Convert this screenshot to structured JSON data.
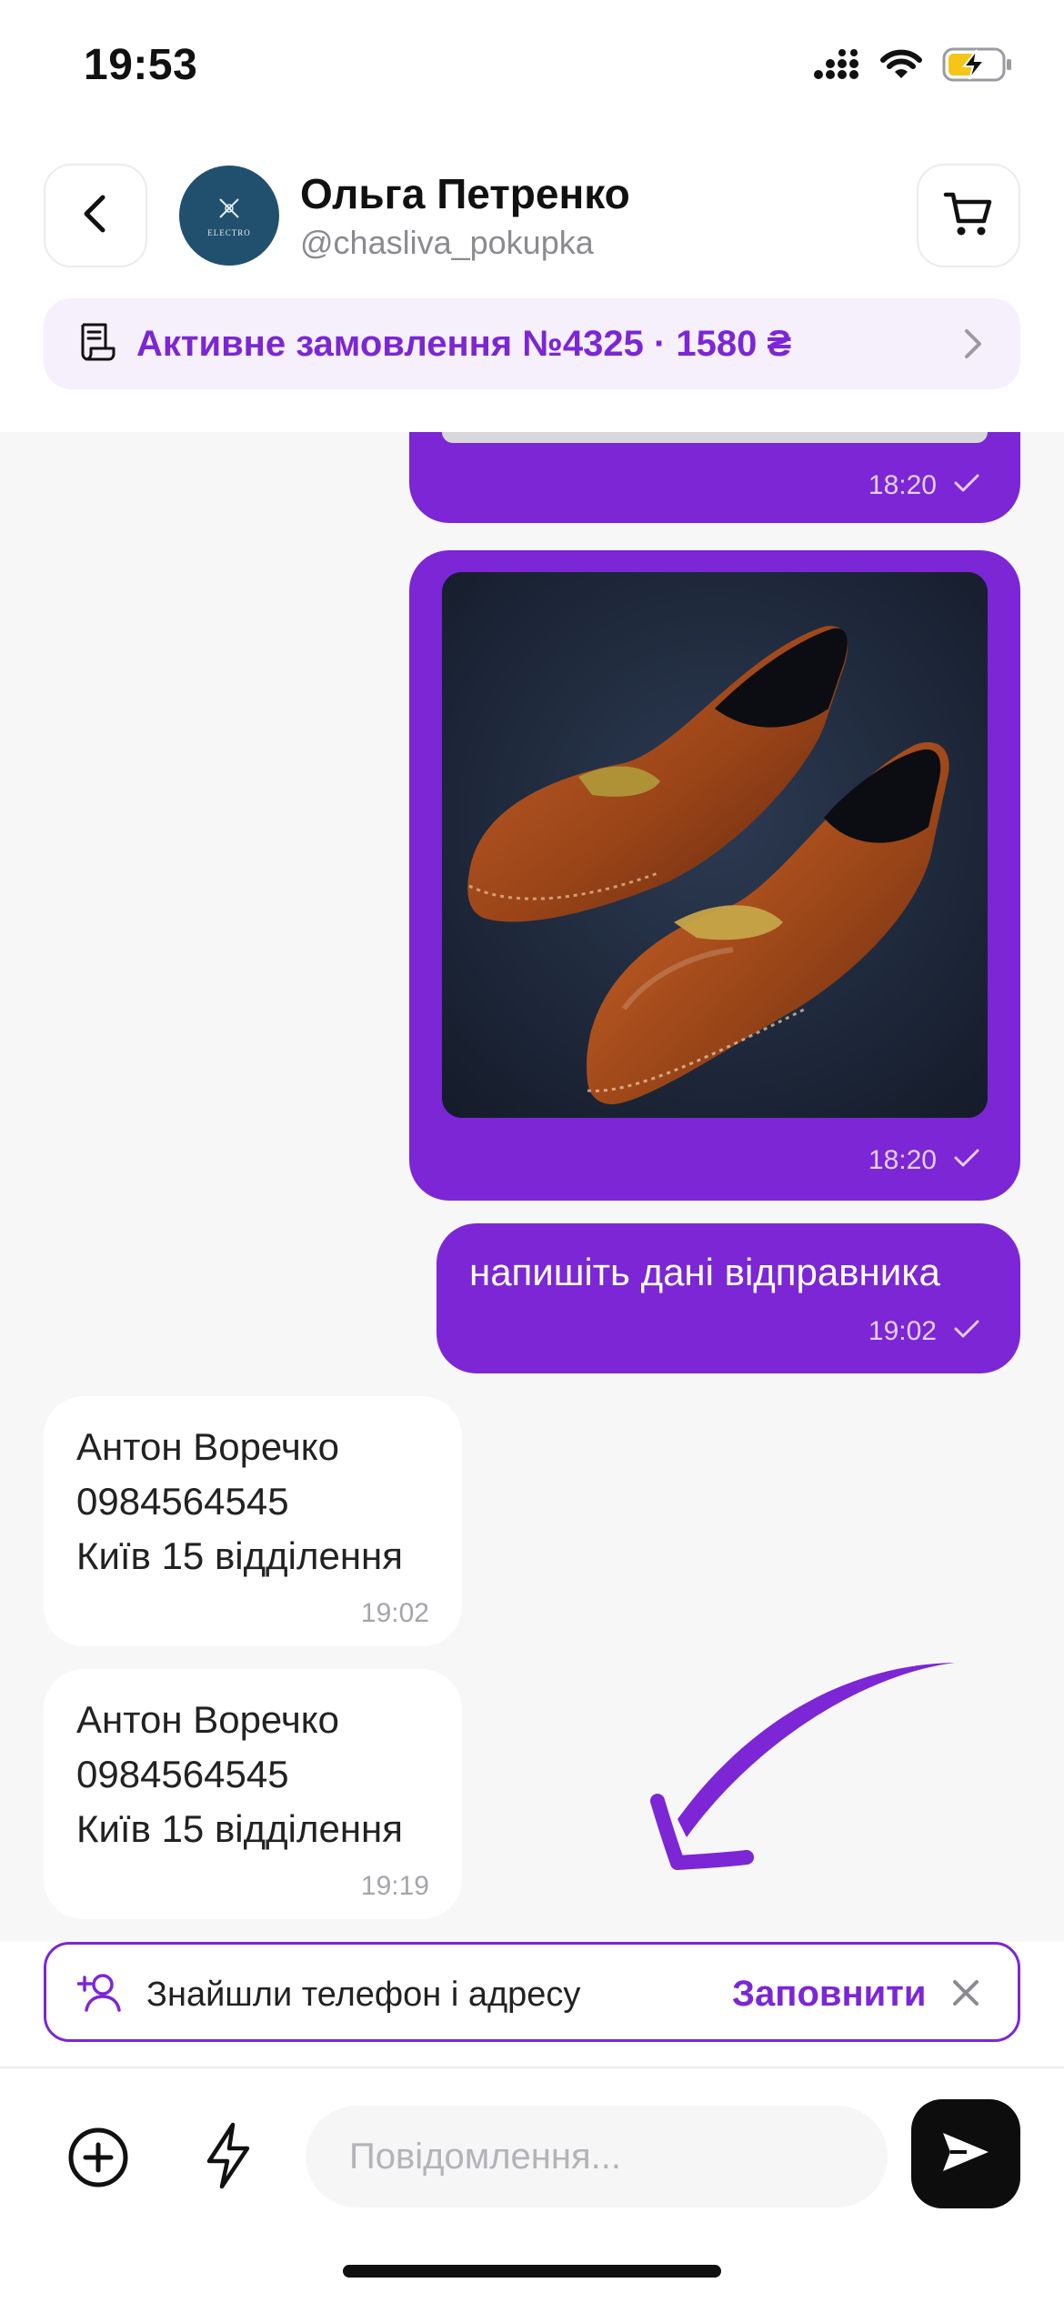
{
  "status_bar": {
    "time": "19:53"
  },
  "header": {
    "contact_name": "Ольга Петренко",
    "contact_handle": "@chasliva_pokupka",
    "avatar_text": "ELECTRO",
    "order_banner": "Активне замовлення №4325 · 1580 ₴"
  },
  "messages": [
    {
      "direction": "out",
      "type": "image",
      "time": "18:20",
      "status": "sent"
    },
    {
      "direction": "out",
      "type": "image",
      "time": "18:20",
      "status": "sent"
    },
    {
      "direction": "out",
      "type": "text",
      "text": "напишіть дані відправника",
      "time": "19:02",
      "status": "sent"
    },
    {
      "direction": "in",
      "type": "text",
      "lines": [
        "Антон Воречко",
        "0984564545",
        "Київ 15 відділення"
      ],
      "time": "19:02"
    },
    {
      "direction": "in",
      "type": "text",
      "lines": [
        "Антон Воречко",
        "0984564545",
        "Київ 15 відділення"
      ],
      "time": "19:19"
    }
  ],
  "suggestion": {
    "text": "Знайшли телефон і адресу",
    "action": "Заповнити"
  },
  "composer": {
    "placeholder": "Повідомлення..."
  },
  "colors": {
    "accent": "#7c26d6",
    "chat_background": "#f7f7f8",
    "send_button": "#0d0d0d"
  }
}
